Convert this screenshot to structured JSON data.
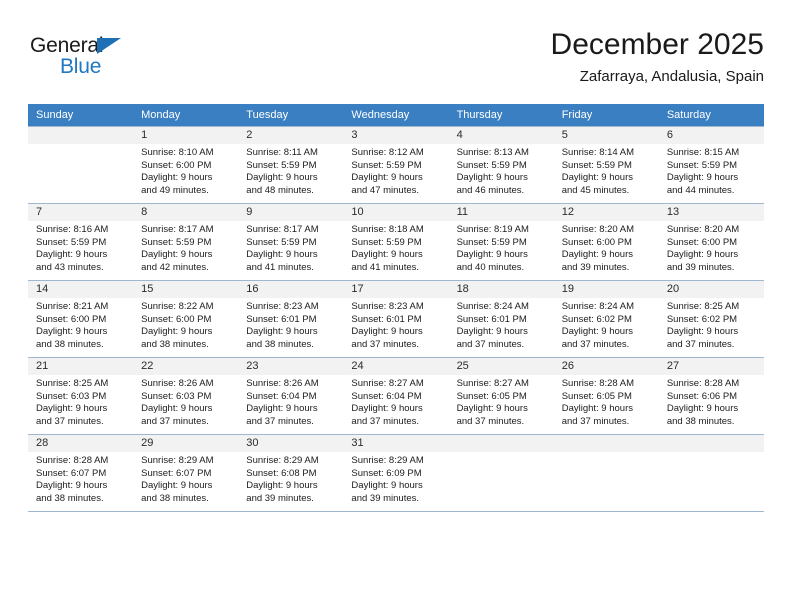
{
  "brand": {
    "name_part1": "General",
    "name_part2": "Blue",
    "triangle_color": "#1f6fb5",
    "blue_color": "#1f78c1"
  },
  "header": {
    "title": "December 2025",
    "subtitle": "Zafarraya, Andalusia, Spain"
  },
  "theme": {
    "header_row_bg": "#3a7fc1",
    "header_row_text": "#ffffff",
    "daynum_bg": "#f2f2f2",
    "grid_line": "#9fb8cf"
  },
  "weekday_headers": [
    "Sunday",
    "Monday",
    "Tuesday",
    "Wednesday",
    "Thursday",
    "Friday",
    "Saturday"
  ],
  "labels": {
    "sunrise_prefix": "Sunrise:",
    "sunset_prefix": "Sunset:",
    "daylight_prefix": "Daylight:"
  },
  "weeks": [
    [
      {
        "day": "",
        "blank": true
      },
      {
        "day": "1",
        "sunrise": "Sunrise: 8:10 AM",
        "sunset": "Sunset: 6:00 PM",
        "daylight_line1": "Daylight: 9 hours",
        "daylight_line2": "and 49 minutes."
      },
      {
        "day": "2",
        "sunrise": "Sunrise: 8:11 AM",
        "sunset": "Sunset: 5:59 PM",
        "daylight_line1": "Daylight: 9 hours",
        "daylight_line2": "and 48 minutes."
      },
      {
        "day": "3",
        "sunrise": "Sunrise: 8:12 AM",
        "sunset": "Sunset: 5:59 PM",
        "daylight_line1": "Daylight: 9 hours",
        "daylight_line2": "and 47 minutes."
      },
      {
        "day": "4",
        "sunrise": "Sunrise: 8:13 AM",
        "sunset": "Sunset: 5:59 PM",
        "daylight_line1": "Daylight: 9 hours",
        "daylight_line2": "and 46 minutes."
      },
      {
        "day": "5",
        "sunrise": "Sunrise: 8:14 AM",
        "sunset": "Sunset: 5:59 PM",
        "daylight_line1": "Daylight: 9 hours",
        "daylight_line2": "and 45 minutes."
      },
      {
        "day": "6",
        "sunrise": "Sunrise: 8:15 AM",
        "sunset": "Sunset: 5:59 PM",
        "daylight_line1": "Daylight: 9 hours",
        "daylight_line2": "and 44 minutes."
      }
    ],
    [
      {
        "day": "7",
        "sunrise": "Sunrise: 8:16 AM",
        "sunset": "Sunset: 5:59 PM",
        "daylight_line1": "Daylight: 9 hours",
        "daylight_line2": "and 43 minutes."
      },
      {
        "day": "8",
        "sunrise": "Sunrise: 8:17 AM",
        "sunset": "Sunset: 5:59 PM",
        "daylight_line1": "Daylight: 9 hours",
        "daylight_line2": "and 42 minutes."
      },
      {
        "day": "9",
        "sunrise": "Sunrise: 8:17 AM",
        "sunset": "Sunset: 5:59 PM",
        "daylight_line1": "Daylight: 9 hours",
        "daylight_line2": "and 41 minutes."
      },
      {
        "day": "10",
        "sunrise": "Sunrise: 8:18 AM",
        "sunset": "Sunset: 5:59 PM",
        "daylight_line1": "Daylight: 9 hours",
        "daylight_line2": "and 41 minutes."
      },
      {
        "day": "11",
        "sunrise": "Sunrise: 8:19 AM",
        "sunset": "Sunset: 5:59 PM",
        "daylight_line1": "Daylight: 9 hours",
        "daylight_line2": "and 40 minutes."
      },
      {
        "day": "12",
        "sunrise": "Sunrise: 8:20 AM",
        "sunset": "Sunset: 6:00 PM",
        "daylight_line1": "Daylight: 9 hours",
        "daylight_line2": "and 39 minutes."
      },
      {
        "day": "13",
        "sunrise": "Sunrise: 8:20 AM",
        "sunset": "Sunset: 6:00 PM",
        "daylight_line1": "Daylight: 9 hours",
        "daylight_line2": "and 39 minutes."
      }
    ],
    [
      {
        "day": "14",
        "sunrise": "Sunrise: 8:21 AM",
        "sunset": "Sunset: 6:00 PM",
        "daylight_line1": "Daylight: 9 hours",
        "daylight_line2": "and 38 minutes."
      },
      {
        "day": "15",
        "sunrise": "Sunrise: 8:22 AM",
        "sunset": "Sunset: 6:00 PM",
        "daylight_line1": "Daylight: 9 hours",
        "daylight_line2": "and 38 minutes."
      },
      {
        "day": "16",
        "sunrise": "Sunrise: 8:23 AM",
        "sunset": "Sunset: 6:01 PM",
        "daylight_line1": "Daylight: 9 hours",
        "daylight_line2": "and 38 minutes."
      },
      {
        "day": "17",
        "sunrise": "Sunrise: 8:23 AM",
        "sunset": "Sunset: 6:01 PM",
        "daylight_line1": "Daylight: 9 hours",
        "daylight_line2": "and 37 minutes."
      },
      {
        "day": "18",
        "sunrise": "Sunrise: 8:24 AM",
        "sunset": "Sunset: 6:01 PM",
        "daylight_line1": "Daylight: 9 hours",
        "daylight_line2": "and 37 minutes."
      },
      {
        "day": "19",
        "sunrise": "Sunrise: 8:24 AM",
        "sunset": "Sunset: 6:02 PM",
        "daylight_line1": "Daylight: 9 hours",
        "daylight_line2": "and 37 minutes."
      },
      {
        "day": "20",
        "sunrise": "Sunrise: 8:25 AM",
        "sunset": "Sunset: 6:02 PM",
        "daylight_line1": "Daylight: 9 hours",
        "daylight_line2": "and 37 minutes."
      }
    ],
    [
      {
        "day": "21",
        "sunrise": "Sunrise: 8:25 AM",
        "sunset": "Sunset: 6:03 PM",
        "daylight_line1": "Daylight: 9 hours",
        "daylight_line2": "and 37 minutes."
      },
      {
        "day": "22",
        "sunrise": "Sunrise: 8:26 AM",
        "sunset": "Sunset: 6:03 PM",
        "daylight_line1": "Daylight: 9 hours",
        "daylight_line2": "and 37 minutes."
      },
      {
        "day": "23",
        "sunrise": "Sunrise: 8:26 AM",
        "sunset": "Sunset: 6:04 PM",
        "daylight_line1": "Daylight: 9 hours",
        "daylight_line2": "and 37 minutes."
      },
      {
        "day": "24",
        "sunrise": "Sunrise: 8:27 AM",
        "sunset": "Sunset: 6:04 PM",
        "daylight_line1": "Daylight: 9 hours",
        "daylight_line2": "and 37 minutes."
      },
      {
        "day": "25",
        "sunrise": "Sunrise: 8:27 AM",
        "sunset": "Sunset: 6:05 PM",
        "daylight_line1": "Daylight: 9 hours",
        "daylight_line2": "and 37 minutes."
      },
      {
        "day": "26",
        "sunrise": "Sunrise: 8:28 AM",
        "sunset": "Sunset: 6:05 PM",
        "daylight_line1": "Daylight: 9 hours",
        "daylight_line2": "and 37 minutes."
      },
      {
        "day": "27",
        "sunrise": "Sunrise: 8:28 AM",
        "sunset": "Sunset: 6:06 PM",
        "daylight_line1": "Daylight: 9 hours",
        "daylight_line2": "and 38 minutes."
      }
    ],
    [
      {
        "day": "28",
        "sunrise": "Sunrise: 8:28 AM",
        "sunset": "Sunset: 6:07 PM",
        "daylight_line1": "Daylight: 9 hours",
        "daylight_line2": "and 38 minutes."
      },
      {
        "day": "29",
        "sunrise": "Sunrise: 8:29 AM",
        "sunset": "Sunset: 6:07 PM",
        "daylight_line1": "Daylight: 9 hours",
        "daylight_line2": "and 38 minutes."
      },
      {
        "day": "30",
        "sunrise": "Sunrise: 8:29 AM",
        "sunset": "Sunset: 6:08 PM",
        "daylight_line1": "Daylight: 9 hours",
        "daylight_line2": "and 39 minutes."
      },
      {
        "day": "31",
        "sunrise": "Sunrise: 8:29 AM",
        "sunset": "Sunset: 6:09 PM",
        "daylight_line1": "Daylight: 9 hours",
        "daylight_line2": "and 39 minutes."
      },
      {
        "day": "",
        "blank": true
      },
      {
        "day": "",
        "blank": true
      },
      {
        "day": "",
        "blank": true
      }
    ]
  ]
}
